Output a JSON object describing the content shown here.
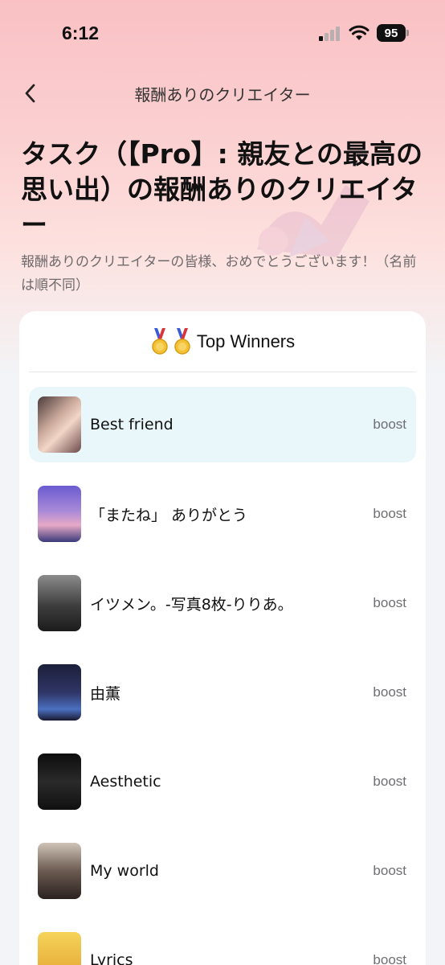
{
  "status_bar": {
    "time": "6:12",
    "battery": "95"
  },
  "nav": {
    "title": "報酬ありのクリエイター"
  },
  "headline": {
    "title": "タスク（【Pro】: 親友との最高の思い出）の報酬ありのクリエイター",
    "subtitle": "報酬ありのクリエイターの皆様、おめでとうございます！（名前は順不同）"
  },
  "card": {
    "title": "Top Winners",
    "medal_icons": [
      "medal-icon",
      "medal-icon"
    ]
  },
  "winners": [
    {
      "name": "Best friend",
      "action": "boost"
    },
    {
      "name": "「またね」 ありがとう",
      "action": "boost"
    },
    {
      "name": "イツメン。-写真8枚-りりあ。",
      "action": "boost"
    },
    {
      "name": "由薫",
      "action": "boost"
    },
    {
      "name": "Aesthetic",
      "action": "boost"
    },
    {
      "name": "My world",
      "action": "boost"
    },
    {
      "name": "Lyrics",
      "action": "boost"
    }
  ],
  "colors": {
    "header_gradient_top": "#f9c1c4",
    "highlight_row": "#e9f7fa",
    "background": "#f2f4f7"
  }
}
